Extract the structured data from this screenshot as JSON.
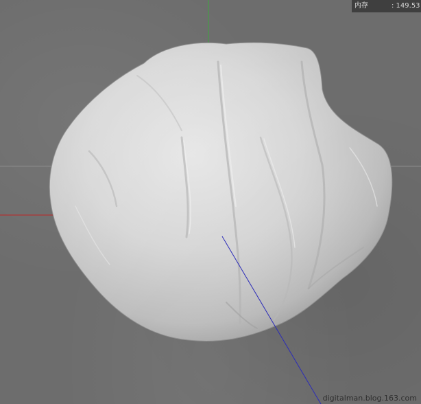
{
  "overlay": {
    "memory_label": "内存",
    "memory_value": ": 149.53"
  },
  "watermark": "digitalman.blog.163.com",
  "axes": {
    "x_axis_color": "#c02424",
    "y_axis_color": "#3fa63f",
    "z_axis_color": "#2b2bb8",
    "grid_line_color": "#8a8a8a"
  },
  "scene": {
    "object": "cloth-sack-sculpt",
    "material_color": "#d9d9d9",
    "background_color": "#6d6d6d"
  }
}
